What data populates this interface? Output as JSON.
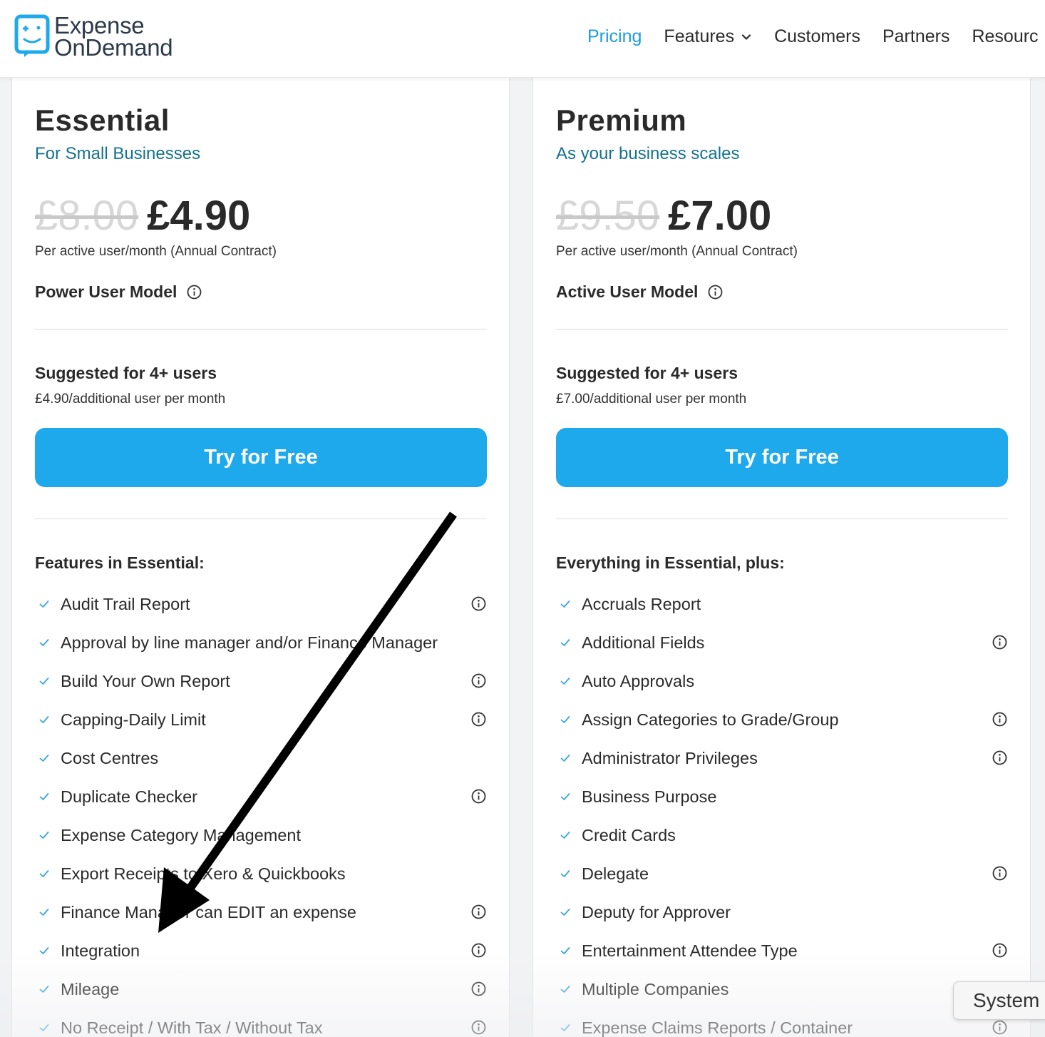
{
  "header": {
    "logo_line1": "Expense",
    "logo_line2": "OnDemand",
    "nav": [
      {
        "label": "Pricing",
        "active": true
      },
      {
        "label": "Features",
        "has_dropdown": true
      },
      {
        "label": "Customers"
      },
      {
        "label": "Partners"
      },
      {
        "label": "Resourc"
      }
    ]
  },
  "plans": [
    {
      "title": "Essential",
      "subtitle": "For Small Businesses",
      "old_price": "£8.00",
      "new_price": "£4.90",
      "price_note": "Per active user/month (Annual Contract)",
      "model": "Power User Model",
      "suggested": "Suggested for 4+ users",
      "additional": "£4.90/additional user per month",
      "cta": "Try for Free",
      "features_heading": "Features in Essential:",
      "features": [
        {
          "label": "Audit Trail Report",
          "info": true
        },
        {
          "label": "Approval by line manager and/or Finance Manager",
          "info": false
        },
        {
          "label": "Build Your Own Report",
          "info": true
        },
        {
          "label": "Capping-Daily Limit",
          "info": true
        },
        {
          "label": "Cost Centres",
          "info": false
        },
        {
          "label": "Duplicate Checker",
          "info": true
        },
        {
          "label": "Expense Category Management",
          "info": false
        },
        {
          "label": "Export Receipts to Xero & Quickbooks",
          "info": false
        },
        {
          "label": "Finance Manager can EDIT an expense",
          "info": true
        },
        {
          "label": "Integration",
          "info": true
        },
        {
          "label": "Mileage",
          "info": true
        },
        {
          "label": "No Receipt / With Tax / Without Tax",
          "info": true
        }
      ]
    },
    {
      "title": "Premium",
      "subtitle": "As your business scales",
      "old_price": "£9.50",
      "new_price": "£7.00",
      "price_note": "Per active user/month (Annual Contract)",
      "model": "Active User Model",
      "suggested": "Suggested for 4+ users",
      "additional": "£7.00/additional user per month",
      "cta": "Try for Free",
      "features_heading": "Everything in Essential, plus:",
      "features": [
        {
          "label": "Accruals Report",
          "info": false
        },
        {
          "label": "Additional Fields",
          "info": true
        },
        {
          "label": "Auto Approvals",
          "info": false
        },
        {
          "label": "Assign Categories to Grade/Group",
          "info": true
        },
        {
          "label": "Administrator Privileges",
          "info": true
        },
        {
          "label": "Business Purpose",
          "info": false
        },
        {
          "label": "Credit Cards",
          "info": false
        },
        {
          "label": "Delegate",
          "info": true
        },
        {
          "label": "Deputy for Approver",
          "info": false
        },
        {
          "label": "Entertainment Attendee Type",
          "info": true
        },
        {
          "label": "Multiple Companies",
          "info": false
        },
        {
          "label": "Expense Claims Reports / Container",
          "info": true
        }
      ]
    }
  ],
  "system_button": "System",
  "colors": {
    "accent": "#1a9be6",
    "cta": "#1da9ec",
    "subtitle": "#13728f",
    "check": "#3aa6dd"
  },
  "icons": {
    "logo": "chat-bubble-logo-icon",
    "info": "info-circle-icon",
    "check": "check-icon",
    "chevron": "chevron-down-icon",
    "annotation": "arrow-annotation"
  }
}
